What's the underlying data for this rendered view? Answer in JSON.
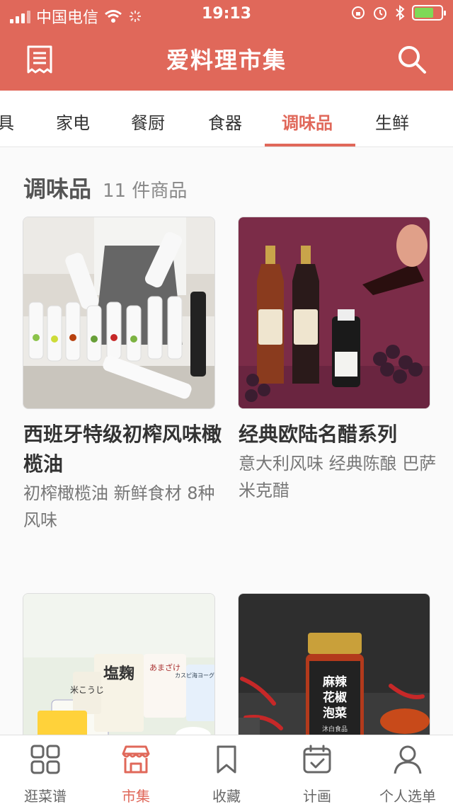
{
  "status_bar": {
    "carrier": "中国电信",
    "time": "19:13"
  },
  "header": {
    "title": "爱料理市集",
    "left_icon": "receipt-icon",
    "right_icon": "search-icon"
  },
  "category_tabs": [
    {
      "label": "具"
    },
    {
      "label": "家电"
    },
    {
      "label": "餐厨"
    },
    {
      "label": "食器"
    },
    {
      "label": "调味品",
      "active": true
    },
    {
      "label": "生鲜"
    }
  ],
  "section": {
    "title": "调味品",
    "count": "11 件商品"
  },
  "products": [
    {
      "title": "西班牙特级初榨风味橄榄油",
      "subtitle": "初榨橄榄油 新鲜食材 8种风味"
    },
    {
      "title": "经典欧陆名醋系列",
      "subtitle": "意大利风味 经典陈酿 巴萨米克醋"
    },
    {
      "jar_label": "塩麹",
      "label_2": "米こうじ",
      "label_3": "あまざけ",
      "label_4": "カスピ海ヨーグルト"
    },
    {
      "jar_label": "麻辣花椒泡菜",
      "jar_brand": "沐白食品"
    }
  ],
  "tabbar": [
    {
      "label": "逛菜谱",
      "icon": "grid-icon"
    },
    {
      "label": "市集",
      "icon": "store-icon",
      "active": true
    },
    {
      "label": "收藏",
      "icon": "bookmark-icon"
    },
    {
      "label": "计画",
      "icon": "calendar-check-icon"
    },
    {
      "label": "个人选单",
      "icon": "user-icon"
    }
  ],
  "colors": {
    "brand": "#e0685a",
    "background": "#fafafa"
  }
}
